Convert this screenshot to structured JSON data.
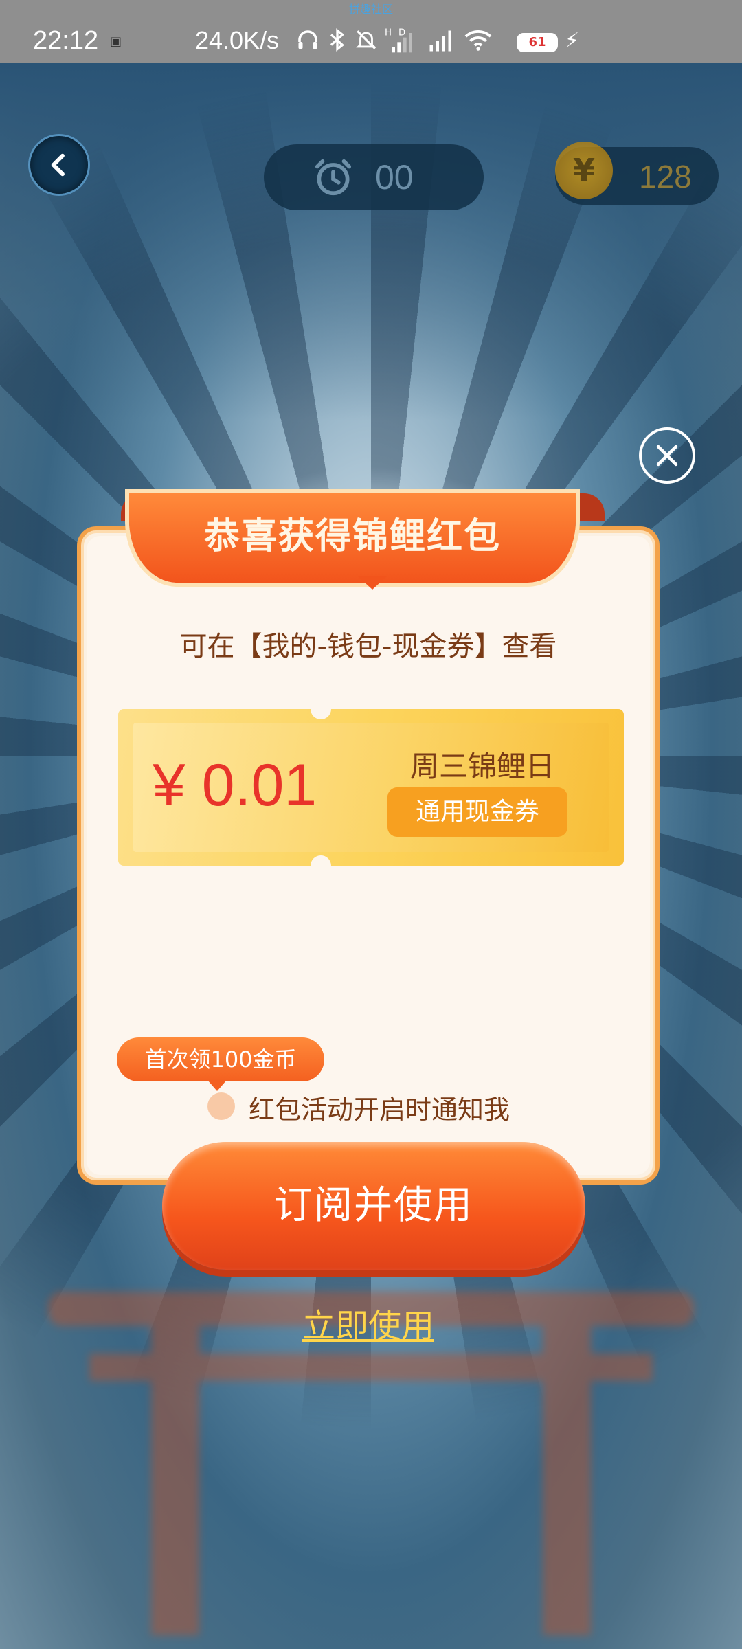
{
  "status_bar": {
    "time": "22:12",
    "network_speed": "24.0K/s",
    "top_label": "拼趣社区",
    "battery_level": "61",
    "icons": [
      "headphones-icon",
      "bluetooth-icon",
      "mute-bell-icon",
      "hd-signal-icon",
      "signal-icon",
      "wifi-icon",
      "battery-icon",
      "charging-icon"
    ]
  },
  "game_bar": {
    "timer_value": "00",
    "coin_value": "128",
    "coin_symbol": "¥"
  },
  "dialog": {
    "title": "恭喜获得锦鲤红包",
    "hint": "可在【我的-钱包-现金券】查看",
    "coupon": {
      "amount": "¥ 0.01",
      "name": "周三锦鲤日",
      "type": "通用现金券"
    },
    "badge": "首次领100金币",
    "notify_label": "红包活动开启时通知我",
    "notify_checked": false,
    "primary_button": "订阅并使用",
    "secondary_link": "立即使用"
  },
  "colors": {
    "accent_orange": "#f6561c",
    "coupon_red": "#e8332a",
    "link_yellow": "#ffd54a"
  }
}
